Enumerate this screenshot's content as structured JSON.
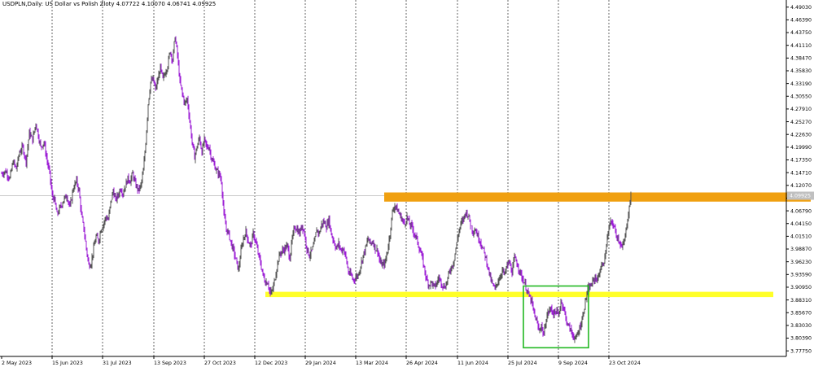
{
  "chart_data": {
    "type": "candlestick",
    "symbol": "USDPLN",
    "timeframe": "Daily",
    "description": "US Dollar vs Polish Zloty",
    "ohlc": {
      "open": "4.07722",
      "high": "4.10070",
      "low": "4.06741",
      "close": "4.09925"
    },
    "last_price_label": "4.09925",
    "y_ticks": [
      "4.49030",
      "4.46390",
      "4.43750",
      "4.41110",
      "4.38470",
      "4.35830",
      "4.33190",
      "4.30550",
      "4.27910",
      "4.25270",
      "4.22630",
      "4.19990",
      "4.17350",
      "4.14710",
      "4.12070",
      "4.09430",
      "4.06790",
      "4.04150",
      "4.01510",
      "3.98870",
      "3.96230",
      "3.93590",
      "3.90950",
      "3.88310",
      "3.85670",
      "3.83030",
      "3.80390",
      "3.77750"
    ],
    "ylim": [
      3.766,
      4.5
    ],
    "x_ticks": [
      "2 May 2023",
      "15 Jun 2023",
      "31 Jul 2023",
      "13 Sep 2023",
      "27 Oct 2023",
      "12 Dec 2023",
      "29 Jan 2024",
      "13 Mar 2024",
      "26 Apr 2024",
      "11 Jun 2024",
      "25 Jul 2024",
      "9 Sep 2024",
      "23 Oct 2024"
    ],
    "price_path": [
      [
        0,
        4.145
      ],
      [
        5,
        4.15
      ],
      [
        10,
        4.135
      ],
      [
        14,
        4.17
      ],
      [
        18,
        4.155
      ],
      [
        22,
        4.19
      ],
      [
        26,
        4.2
      ],
      [
        30,
        4.17
      ],
      [
        34,
        4.23
      ],
      [
        38,
        4.215
      ],
      [
        42,
        4.25
      ],
      [
        45,
        4.225
      ],
      [
        48,
        4.2
      ],
      [
        52,
        4.21
      ],
      [
        56,
        4.17
      ],
      [
        59,
        4.145
      ],
      [
        62,
        4.1
      ],
      [
        65,
        4.09
      ],
      [
        68,
        4.06
      ],
      [
        72,
        4.075
      ],
      [
        76,
        4.09
      ],
      [
        80,
        4.1
      ],
      [
        84,
        4.075
      ],
      [
        88,
        4.115
      ],
      [
        92,
        4.13
      ],
      [
        95,
        4.11
      ],
      [
        98,
        4.06
      ],
      [
        101,
        4.03
      ],
      [
        104,
        3.99
      ],
      [
        107,
        3.955
      ],
      [
        110,
        3.96
      ],
      [
        113,
        3.99
      ],
      [
        116,
        4.015
      ],
      [
        119,
        4.005
      ],
      [
        122,
        4.03
      ],
      [
        125,
        4.04
      ],
      [
        128,
        4.055
      ],
      [
        131,
        4.05
      ],
      [
        134,
        4.085
      ],
      [
        137,
        4.11
      ],
      [
        140,
        4.09
      ],
      [
        143,
        4.1
      ],
      [
        146,
        4.115
      ],
      [
        149,
        4.105
      ],
      [
        152,
        4.12
      ],
      [
        155,
        4.135
      ],
      [
        158,
        4.13
      ],
      [
        161,
        4.145
      ],
      [
        164,
        4.125
      ],
      [
        168,
        4.11
      ],
      [
        171,
        4.12
      ],
      [
        174,
        4.15
      ],
      [
        177,
        4.21
      ],
      [
        180,
        4.29
      ],
      [
        183,
        4.335
      ],
      [
        186,
        4.34
      ],
      [
        189,
        4.32
      ],
      [
        192,
        4.34
      ],
      [
        195,
        4.365
      ],
      [
        198,
        4.34
      ],
      [
        201,
        4.355
      ],
      [
        204,
        4.37
      ],
      [
        207,
        4.4
      ],
      [
        210,
        4.38
      ],
      [
        213,
        4.43
      ],
      [
        216,
        4.39
      ],
      [
        219,
        4.335
      ],
      [
        222,
        4.31
      ],
      [
        225,
        4.29
      ],
      [
        228,
        4.3
      ],
      [
        231,
        4.255
      ],
      [
        234,
        4.21
      ],
      [
        237,
        4.18
      ],
      [
        240,
        4.2
      ],
      [
        243,
        4.22
      ],
      [
        246,
        4.19
      ],
      [
        249,
        4.215
      ],
      [
        252,
        4.2
      ],
      [
        255,
        4.2
      ],
      [
        258,
        4.175
      ],
      [
        261,
        4.165
      ],
      [
        264,
        4.15
      ],
      [
        267,
        4.145
      ],
      [
        270,
        4.13
      ],
      [
        273,
        4.06
      ],
      [
        276,
        4.03
      ],
      [
        279,
        4.02
      ],
      [
        282,
        4.0
      ],
      [
        285,
        3.985
      ],
      [
        288,
        3.965
      ],
      [
        291,
        3.945
      ],
      [
        294,
        3.985
      ],
      [
        297,
        4.01
      ],
      [
        300,
        4.025
      ],
      [
        303,
        4.005
      ],
      [
        306,
        3.995
      ],
      [
        309,
        4.02
      ],
      [
        312,
        4.005
      ],
      [
        315,
        3.98
      ],
      [
        318,
        3.96
      ],
      [
        321,
        3.935
      ],
      [
        324,
        3.92
      ],
      [
        327,
        3.92
      ],
      [
        330,
        3.895
      ],
      [
        333,
        3.905
      ],
      [
        336,
        3.93
      ],
      [
        339,
        3.96
      ],
      [
        342,
        3.98
      ],
      [
        345,
        3.985
      ],
      [
        348,
        3.99
      ],
      [
        351,
        3.995
      ],
      [
        354,
        3.97
      ],
      [
        357,
        4.01
      ],
      [
        360,
        4.035
      ],
      [
        363,
        4.03
      ],
      [
        366,
        4.02
      ],
      [
        369,
        4.04
      ],
      [
        372,
        4.02
      ],
      [
        375,
        3.99
      ],
      [
        378,
        3.975
      ],
      [
        381,
        3.985
      ],
      [
        384,
        4.0
      ],
      [
        387,
        4.03
      ],
      [
        390,
        4.02
      ],
      [
        393,
        4.04
      ],
      [
        396,
        4.045
      ],
      [
        399,
        4.035
      ],
      [
        402,
        4.05
      ],
      [
        405,
        4.02
      ],
      [
        408,
        4.005
      ],
      [
        411,
        3.99
      ],
      [
        414,
        4.0
      ],
      [
        417,
        3.985
      ],
      [
        420,
        3.99
      ],
      [
        423,
        3.97
      ],
      [
        426,
        3.94
      ],
      [
        429,
        3.935
      ],
      [
        432,
        3.925
      ],
      [
        435,
        3.93
      ],
      [
        438,
        3.935
      ],
      [
        441,
        3.955
      ],
      [
        444,
        3.975
      ],
      [
        447,
        3.99
      ],
      [
        450,
        4.01
      ],
      [
        453,
        4.0
      ],
      [
        456,
        4.005
      ],
      [
        459,
        3.99
      ],
      [
        462,
        3.985
      ],
      [
        465,
        3.96
      ],
      [
        468,
        3.955
      ],
      [
        471,
        3.96
      ],
      [
        474,
        3.985
      ],
      [
        477,
        4.02
      ],
      [
        480,
        4.065
      ],
      [
        483,
        4.08
      ],
      [
        486,
        4.07
      ],
      [
        489,
        4.06
      ],
      [
        492,
        4.05
      ],
      [
        495,
        4.04
      ],
      [
        498,
        4.055
      ],
      [
        501,
        4.04
      ],
      [
        504,
        4.035
      ],
      [
        507,
        4.02
      ],
      [
        510,
        4.01
      ],
      [
        513,
        3.99
      ],
      [
        516,
        3.975
      ],
      [
        519,
        3.95
      ],
      [
        522,
        3.925
      ],
      [
        525,
        3.915
      ],
      [
        528,
        3.92
      ],
      [
        531,
        3.91
      ],
      [
        534,
        3.915
      ],
      [
        537,
        3.93
      ],
      [
        540,
        3.92
      ],
      [
        543,
        3.91
      ],
      [
        546,
        3.915
      ],
      [
        549,
        3.935
      ],
      [
        552,
        3.95
      ],
      [
        555,
        3.96
      ],
      [
        558,
        3.99
      ],
      [
        561,
        4.02
      ],
      [
        564,
        4.04
      ],
      [
        567,
        4.05
      ],
      [
        570,
        4.065
      ],
      [
        573,
        4.06
      ],
      [
        576,
        4.04
      ],
      [
        579,
        4.025
      ],
      [
        582,
        4.03
      ],
      [
        585,
        4.015
      ],
      [
        588,
        4.005
      ],
      [
        591,
        3.99
      ],
      [
        594,
        3.975
      ],
      [
        597,
        3.955
      ],
      [
        600,
        3.93
      ],
      [
        603,
        3.915
      ],
      [
        606,
        3.905
      ],
      [
        609,
        3.92
      ],
      [
        612,
        3.93
      ],
      [
        615,
        3.945
      ],
      [
        618,
        3.935
      ],
      [
        621,
        3.955
      ],
      [
        624,
        3.96
      ],
      [
        627,
        3.94
      ],
      [
        630,
        3.97
      ],
      [
        633,
        3.96
      ],
      [
        636,
        3.945
      ],
      [
        639,
        3.93
      ],
      [
        642,
        3.92
      ],
      [
        645,
        3.905
      ],
      [
        648,
        3.89
      ],
      [
        651,
        3.88
      ],
      [
        654,
        3.855
      ],
      [
        657,
        3.84
      ],
      [
        660,
        3.82
      ],
      [
        663,
        3.83
      ],
      [
        666,
        3.81
      ],
      [
        669,
        3.845
      ],
      [
        672,
        3.86
      ],
      [
        675,
        3.865
      ],
      [
        678,
        3.855
      ],
      [
        681,
        3.86
      ],
      [
        684,
        3.85
      ],
      [
        687,
        3.88
      ],
      [
        690,
        3.87
      ],
      [
        693,
        3.845
      ],
      [
        696,
        3.83
      ],
      [
        699,
        3.82
      ],
      [
        702,
        3.81
      ],
      [
        705,
        3.8
      ],
      [
        708,
        3.815
      ],
      [
        711,
        3.83
      ],
      [
        714,
        3.85
      ],
      [
        717,
        3.88
      ],
      [
        720,
        3.905
      ],
      [
        723,
        3.91
      ],
      [
        726,
        3.92
      ],
      [
        729,
        3.93
      ],
      [
        732,
        3.925
      ],
      [
        735,
        3.945
      ],
      [
        738,
        3.955
      ],
      [
        741,
        3.97
      ],
      [
        744,
        4.01
      ],
      [
        747,
        4.04
      ],
      [
        750,
        4.045
      ],
      [
        753,
        4.03
      ],
      [
        756,
        4.015
      ],
      [
        759,
        4.005
      ],
      [
        762,
        3.99
      ],
      [
        765,
        4.005
      ],
      [
        768,
        4.04
      ],
      [
        771,
        4.075
      ],
      [
        773,
        4.099
      ]
    ],
    "annotations": {
      "resistance_zone": {
        "low": 4.087,
        "high": 4.106,
        "color": "#f0a010"
      },
      "support_zone": {
        "low": 3.889,
        "high": 3.9,
        "color": "#ffff28"
      },
      "pattern_box": {
        "price_high": 3.912,
        "price_low": 3.784,
        "color": "#22b822"
      }
    },
    "colors": {
      "bull_candle": "#555555",
      "bear_candle": "#9d1fd6",
      "grid_dash": "#404040",
      "price_line": "#c8c8c8",
      "tag_bg": "#c0c0c0"
    }
  }
}
